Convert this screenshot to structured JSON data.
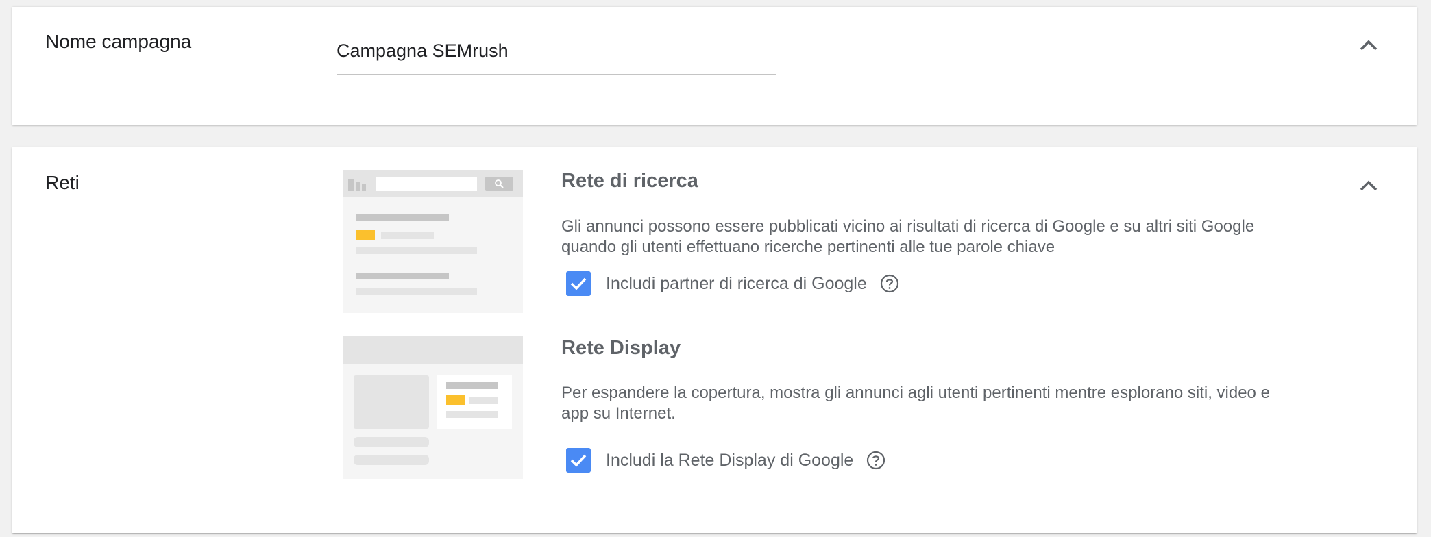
{
  "campaign_name": {
    "label": "Nome campagna",
    "value": "Campagna SEMrush"
  },
  "networks": {
    "label": "Reti",
    "search": {
      "title": "Rete di ricerca",
      "description": "Gli annunci possono essere pubblicati vicino ai risultati di ricerca di Google e su altri siti Google quando gli utenti effettuano ricerche pertinenti alle tue parole chiave",
      "checkbox_label": "Includi partner di ricerca di Google",
      "checked": true
    },
    "display": {
      "title": "Rete Display",
      "description": "Per espandere la copertura, mostra gli annunci agli utenti pertinenti mentre esplorano siti, video e app su Internet.",
      "checkbox_label": "Includi la Rete Display di Google",
      "checked": true
    }
  },
  "icons": {
    "collapse": "chevron-up-icon",
    "help": "help-circle-icon",
    "check": "check-icon"
  },
  "colors": {
    "checkbox": "#4a8af4",
    "accent_yellow": "#fbc02d",
    "text_secondary": "#5f6368"
  }
}
